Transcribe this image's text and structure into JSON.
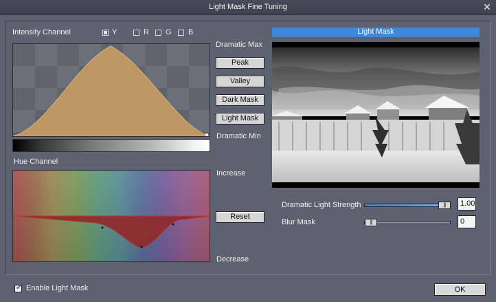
{
  "window": {
    "title": "Light Mask Fine Tuning",
    "close_icon": "close-icon"
  },
  "intensity": {
    "label": "Intensity Channel",
    "channels": [
      {
        "label": "Y",
        "checked": true
      },
      {
        "label": "R",
        "checked": false
      },
      {
        "label": "G",
        "checked": false
      },
      {
        "label": "B",
        "checked": false
      }
    ],
    "dramatic_max": "Dramatic Max",
    "dramatic_min": "Dramatic Min",
    "curve_color": "#c49a63"
  },
  "buttons": {
    "peak": "Peak",
    "valley": "Valley",
    "dark_mask": "Dark Mask",
    "light_mask": "Light Mask",
    "reset": "Reset"
  },
  "hue": {
    "label": "Hue Channel",
    "increase": "Increase",
    "decrease": "Decrease",
    "curve_color": "#8f2a2a"
  },
  "preview": {
    "header": "Light Mask",
    "header_color": "#3f87d8"
  },
  "controls": {
    "strength_label": "Dramatic Light Strength",
    "strength_value": "1.00",
    "strength_level": 1.0,
    "blur_label": "Blur Mask",
    "blur_value": "0",
    "blur_level": 0.0
  },
  "footer": {
    "enable_label": "Enable Light Mask",
    "enable_checked": true,
    "ok": "OK"
  }
}
